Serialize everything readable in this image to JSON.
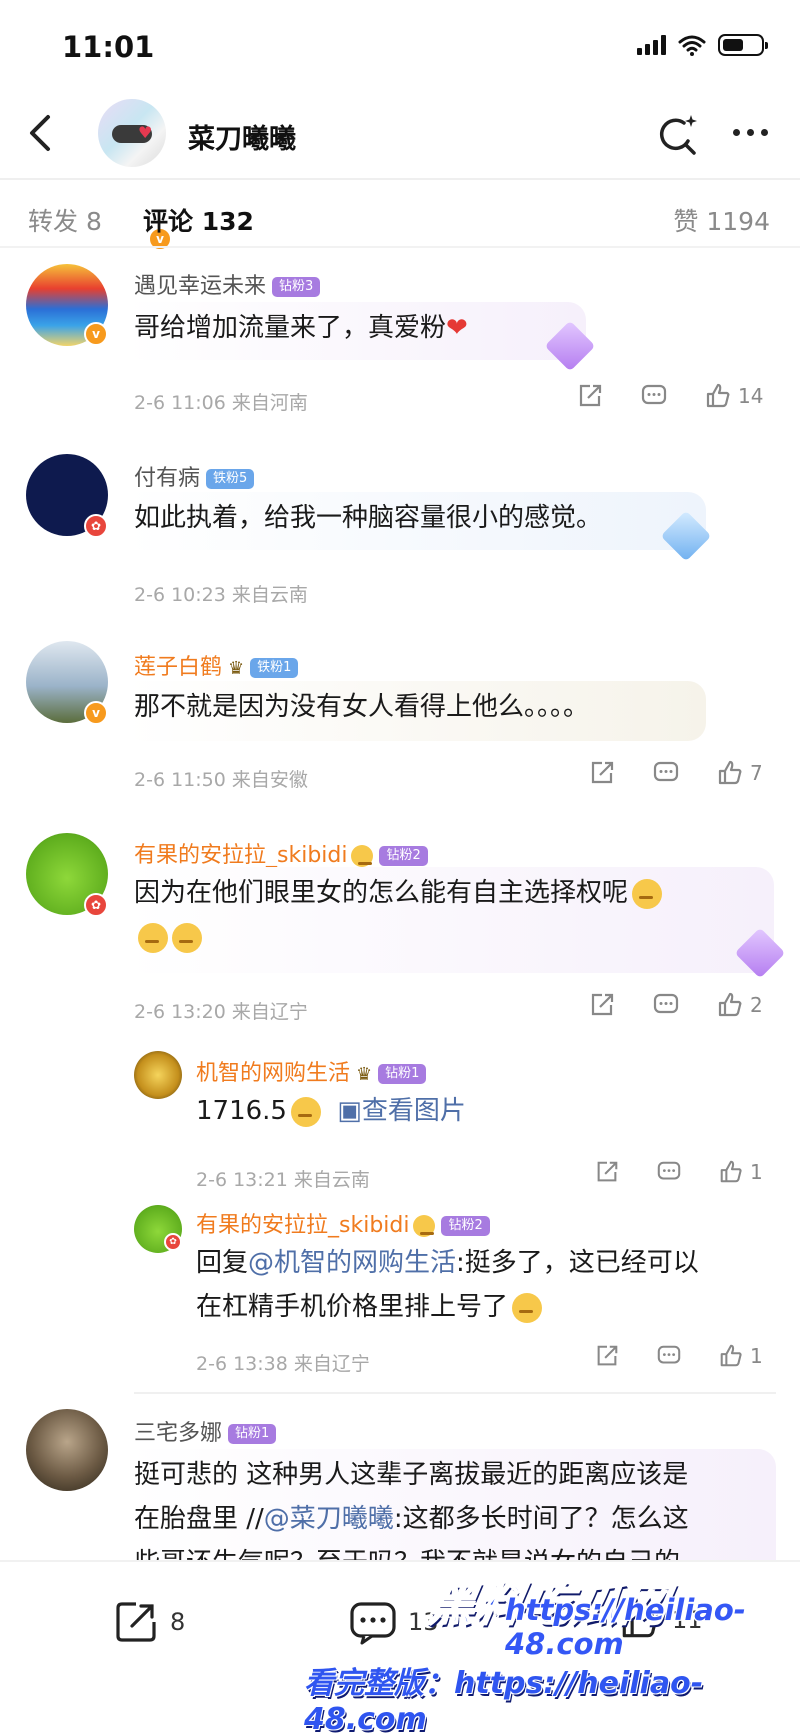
{
  "status_bar": {
    "time": "11:01"
  },
  "header": {
    "title": "菜刀曦曦",
    "verified_badge": "v"
  },
  "tabs": [
    {
      "label": "转发 8"
    },
    {
      "label": "评论 132"
    },
    {
      "label": "赞 1194"
    }
  ],
  "comments": [
    {
      "name": "遇见幸运未来",
      "badge": "钻粉3",
      "text": "哥给增加流量来了，真爱粉",
      "time": "2-6 11:06",
      "location": "来自河南",
      "likes": "14"
    },
    {
      "name": "付有病",
      "badge": "铁粉5",
      "text": "如此执着，给我一种脑容量很小的感觉。",
      "time": "2-6 10:23",
      "location": "来自云南",
      "likes": ""
    },
    {
      "name": "莲子白鹤",
      "badge": "铁粉1",
      "text": "那不就是因为没有女人看得上他么。。。。",
      "time": "2-6 11:50",
      "location": "来自安徽",
      "likes": "7"
    },
    {
      "name": "有果的安拉拉_skibidi",
      "badge": "钻粉2",
      "text": "因为在他们眼里女的怎么能有自主选择权呢",
      "time": "2-6 13:20",
      "location": "来自辽宁",
      "likes": "2",
      "replies": [
        {
          "name": "机智的网购生活",
          "badge": "钻粉1",
          "text": "1716.5",
          "link_text": "查看图片",
          "time": "2-6 13:21",
          "location": "来自云南",
          "likes": "1"
        },
        {
          "name": "有果的安拉拉_skibidi",
          "badge": "钻粉2",
          "reply_prefix": "回复",
          "mention": "@机智的网购生活",
          "text_line1": ":挺多了，这已经可以",
          "text_line2": "在杠精手机价格里排上号了",
          "time": "2-6 13:38",
          "location": "来自辽宁",
          "likes": "1"
        }
      ]
    },
    {
      "name": "三宅多娜",
      "badge": "钻粉1",
      "text_line1": "挺可悲的 这种男人这辈子离拔最近的距离应该是",
      "text_line2_prefix": "在胎盘里 //",
      "mention": "@菜刀曦曦",
      "text_line2_suffix": ":这都多长时间了？怎么这",
      "text_line3": "些哥还生气呢？至于吗？我不就是说女的自己的"
    }
  ],
  "bottom_bar": {
    "forward": "8",
    "comments": "13",
    "likes": "11"
  },
  "watermark": {
    "logo": "黑料吃瓜网",
    "url": "https://heiliao-48.com",
    "caption": "看完整版：https://heiliao-48.com"
  },
  "colors": {
    "name_orange": "#f07b1e",
    "fan_purple": "#a77be0",
    "fan_blue": "#6aa6ea",
    "watermark_blue": "#2d55f0"
  }
}
